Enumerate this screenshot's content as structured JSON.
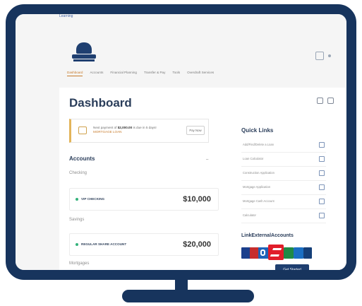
{
  "topbar": {
    "text": "Learning"
  },
  "nav": {
    "items": [
      "Dashboard",
      "Accounts",
      "Financial Planning",
      "Transfer & Pay",
      "Tools",
      "Overdraft Services"
    ],
    "active_index": 0
  },
  "page": {
    "title": "Dashboard"
  },
  "payment": {
    "prefix": "Next payment of ",
    "amount": "$2,000.00",
    "suffix": " is due in 5 days!",
    "link": "MORTGAGE LOAN",
    "button_label": "Pay Now"
  },
  "accounts": {
    "heading": "Accounts",
    "toggle": "–",
    "groups": [
      {
        "label": "Checking",
        "name": "VIP CHECKING",
        "amount": "$10,000"
      },
      {
        "label": "Savings",
        "name": "REGULAR SHARE ACCOUNT",
        "amount": "$20,000"
      }
    ],
    "mortgages_label": "Mortgages"
  },
  "quick_links": {
    "heading": "Quick Links",
    "items": [
      "Add/Find/Delete a Loan",
      "Loan Calculator",
      "Construction Application",
      "Mortgage Application",
      "Mortgage Cash Account",
      "Calculator"
    ]
  },
  "link_external": {
    "heading": "LinkExternalAccounts",
    "button_label": "Get Started"
  },
  "colors": {
    "frame": "#17345d",
    "accent": "#c77b2b",
    "brand": "#1f3f70"
  }
}
